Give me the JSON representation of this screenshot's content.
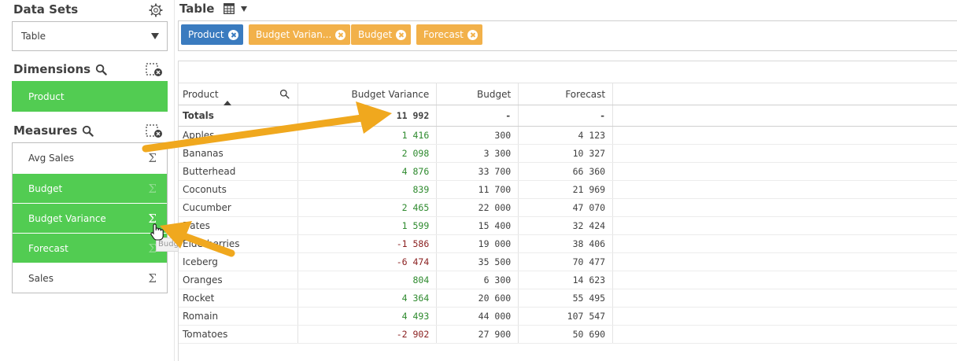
{
  "left_panel": {
    "data_sets": {
      "title": "Data Sets",
      "selected": "Table"
    },
    "dimensions": {
      "title": "Dimensions",
      "items": [
        {
          "label": "Product"
        }
      ]
    },
    "measures": {
      "title": "Measures",
      "items": [
        {
          "label": "Avg Sales",
          "selected": false
        },
        {
          "label": "Budget",
          "selected": true
        },
        {
          "label": "Budget Variance",
          "selected": true
        },
        {
          "label": "Forecast",
          "selected": true
        },
        {
          "label": "Sales",
          "selected": false
        }
      ],
      "sigma": "Σ",
      "tooltip": "Budg"
    }
  },
  "visualization": {
    "title": "Table",
    "chips": [
      {
        "label": "Product",
        "kind": "dimension"
      },
      {
        "label": "Budget Varian...",
        "kind": "measure"
      },
      {
        "label": "Budget",
        "kind": "measure"
      },
      {
        "label": "Forecast",
        "kind": "measure"
      }
    ]
  },
  "table": {
    "headers": [
      "Product",
      "Budget Variance",
      "Budget",
      "Forecast"
    ],
    "totals": {
      "label": "Totals",
      "budget_variance": "11 992",
      "budget": "-",
      "forecast": "-"
    },
    "rows": [
      {
        "product": "Apples",
        "budget_variance": "1 416",
        "budget": "300",
        "forecast": "4 123"
      },
      {
        "product": "Bananas",
        "budget_variance": "2 098",
        "budget": "3 300",
        "forecast": "10 327"
      },
      {
        "product": "Butterhead",
        "budget_variance": "4 876",
        "budget": "33 700",
        "forecast": "66 360"
      },
      {
        "product": "Coconuts",
        "budget_variance": "839",
        "budget": "11 700",
        "forecast": "21 969"
      },
      {
        "product": "Cucumber",
        "budget_variance": "2 465",
        "budget": "22 000",
        "forecast": "47 070"
      },
      {
        "product": "Dates",
        "budget_variance": "1 599",
        "budget": "15 400",
        "forecast": "32 424"
      },
      {
        "product": "Elderberries",
        "budget_variance": "-1 586",
        "budget": "19 000",
        "forecast": "38 406"
      },
      {
        "product": "Iceberg",
        "budget_variance": "-6 474",
        "budget": "35 500",
        "forecast": "70 477"
      },
      {
        "product": "Oranges",
        "budget_variance": "804",
        "budget": "6 300",
        "forecast": "14 623"
      },
      {
        "product": "Rocket",
        "budget_variance": "4 364",
        "budget": "20 600",
        "forecast": "55 495"
      },
      {
        "product": "Romain",
        "budget_variance": "4 493",
        "budget": "44 000",
        "forecast": "107 547"
      },
      {
        "product": "Tomatoes",
        "budget_variance": "-2 902",
        "budget": "27 900",
        "forecast": "50 690"
      }
    ]
  },
  "colors": {
    "selected_green": "#52cc52",
    "dimension_blue": "#3a7bbf",
    "measure_orange": "#f2b14a",
    "positive_text": "#2e8a2e",
    "negative_text": "#8a1f1f",
    "arrow": "#f0a81e"
  },
  "icons": [
    "gear-icon",
    "search-icon",
    "clear-selection-icon",
    "sigma-icon",
    "table-icon",
    "close-icon",
    "hand-cursor-icon"
  ]
}
